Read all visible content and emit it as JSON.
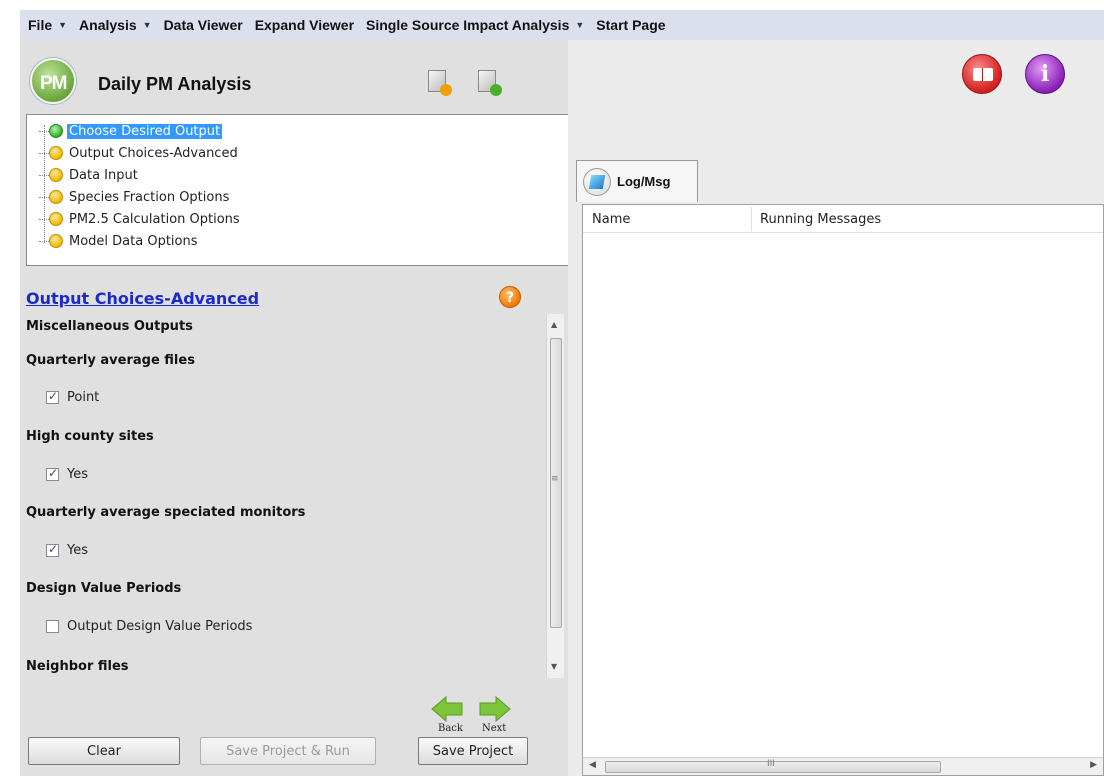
{
  "menu": [
    {
      "label": "File",
      "dropdown": true
    },
    {
      "label": "Analysis",
      "dropdown": true
    },
    {
      "label": "Data Viewer",
      "dropdown": false
    },
    {
      "label": "Expand Viewer",
      "dropdown": false
    },
    {
      "label": "Single Source Impact Analysis",
      "dropdown": true
    },
    {
      "label": "Start Page",
      "dropdown": false
    }
  ],
  "header": {
    "logo_text": "PM",
    "title": "Daily PM Analysis"
  },
  "tree": {
    "items": [
      {
        "label": "Choose Desired Output",
        "status": "green",
        "selected": true
      },
      {
        "label": "Output Choices-Advanced",
        "status": "yellow",
        "selected": false
      },
      {
        "label": "Data Input",
        "status": "yellow",
        "selected": false
      },
      {
        "label": "Species Fraction Options",
        "status": "yellow",
        "selected": false
      },
      {
        "label": "PM2.5 Calculation Options",
        "status": "yellow",
        "selected": false
      },
      {
        "label": "Model Data Options",
        "status": "yellow",
        "selected": false
      }
    ]
  },
  "section": {
    "title": "Output Choices-Advanced",
    "help_icon": "?"
  },
  "options": {
    "misc_heading": "Miscellaneous Outputs",
    "groups": [
      {
        "heading": "Quarterly average files",
        "check_label": "Point",
        "checked": true
      },
      {
        "heading": "High county sites",
        "check_label": "Yes",
        "checked": true
      },
      {
        "heading": "Quarterly average speciated monitors",
        "check_label": "Yes",
        "checked": true
      },
      {
        "heading": "Design Value Periods",
        "check_label": "Output Design Value Periods",
        "checked": false
      }
    ],
    "last_heading": "Neighbor files"
  },
  "nav": {
    "back_label": "Back",
    "next_label": "Next"
  },
  "buttons": {
    "clear": "Clear",
    "save_run": "Save Project & Run",
    "save": "Save Project"
  },
  "log": {
    "tab_label": "Log/Msg",
    "col_name": "Name",
    "col_messages": "Running Messages"
  },
  "colors": {
    "selection": "#3399ff",
    "link": "#1a2bc8",
    "menubar": "#dce0ec"
  }
}
